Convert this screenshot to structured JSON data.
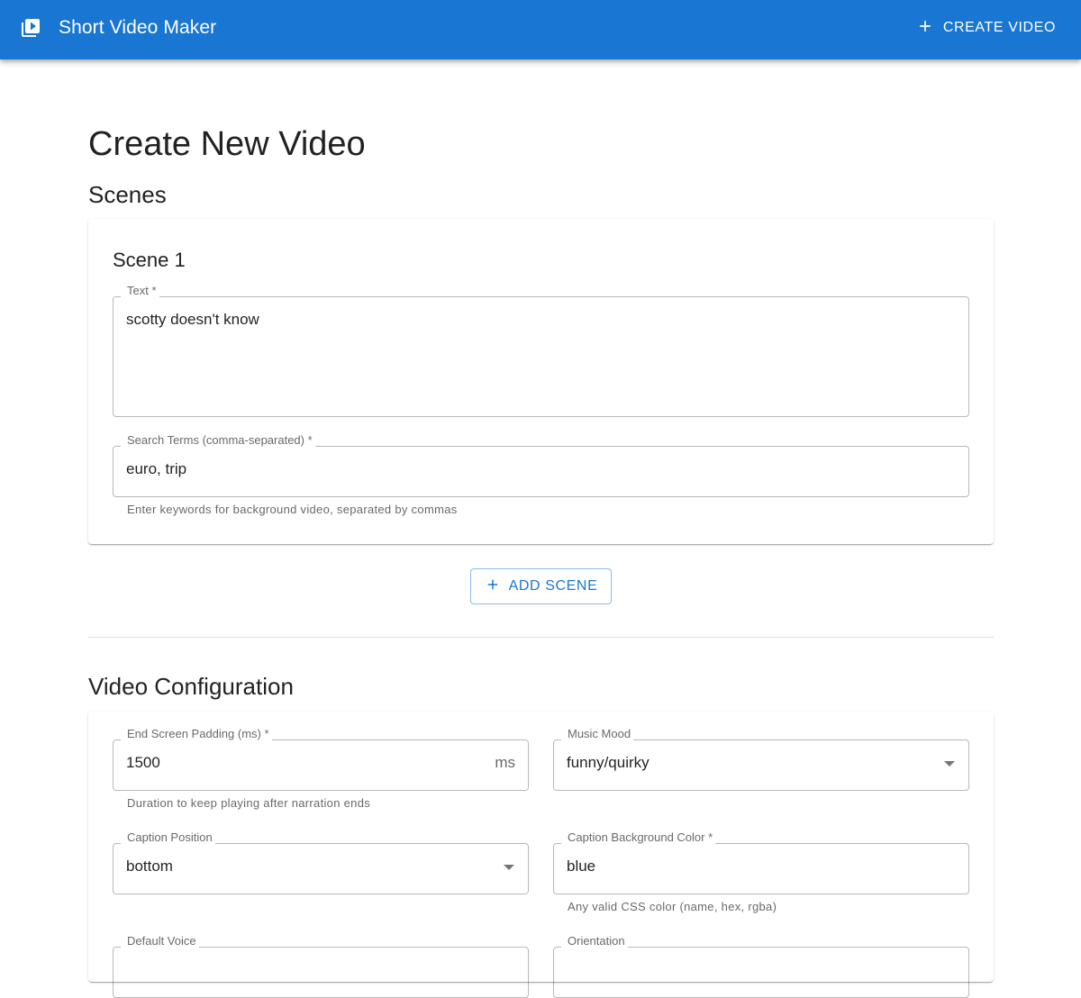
{
  "appbar": {
    "title": "Short Video Maker",
    "logo_icon": "video-library-icon",
    "create_label": "CREATE VIDEO",
    "create_icon": "plus-icon",
    "color": "#1976d2"
  },
  "page": {
    "title": "Create New Video"
  },
  "scenes": {
    "heading": "Scenes",
    "items": [
      {
        "title": "Scene 1",
        "text_label": "Text *",
        "text_value": "scotty doesn't know",
        "search_label": "Search Terms (comma-separated) *",
        "search_value": "euro, trip",
        "search_helper": "Enter keywords for background video, separated by commas"
      }
    ],
    "add_label": "ADD SCENE",
    "add_icon": "plus-icon"
  },
  "config": {
    "heading": "Video Configuration",
    "padding_label": "End Screen Padding (ms) *",
    "padding_value": "1500",
    "padding_unit": "ms",
    "padding_helper": "Duration to keep playing after narration ends",
    "music_label": "Music Mood",
    "music_value": "funny/quirky",
    "caption_pos_label": "Caption Position",
    "caption_pos_value": "bottom",
    "caption_bg_label": "Caption Background Color *",
    "caption_bg_value": "blue",
    "caption_bg_helper": "Any valid CSS color (name, hex, rgba)",
    "voice_label": "Default Voice",
    "orientation_label": "Orientation"
  }
}
